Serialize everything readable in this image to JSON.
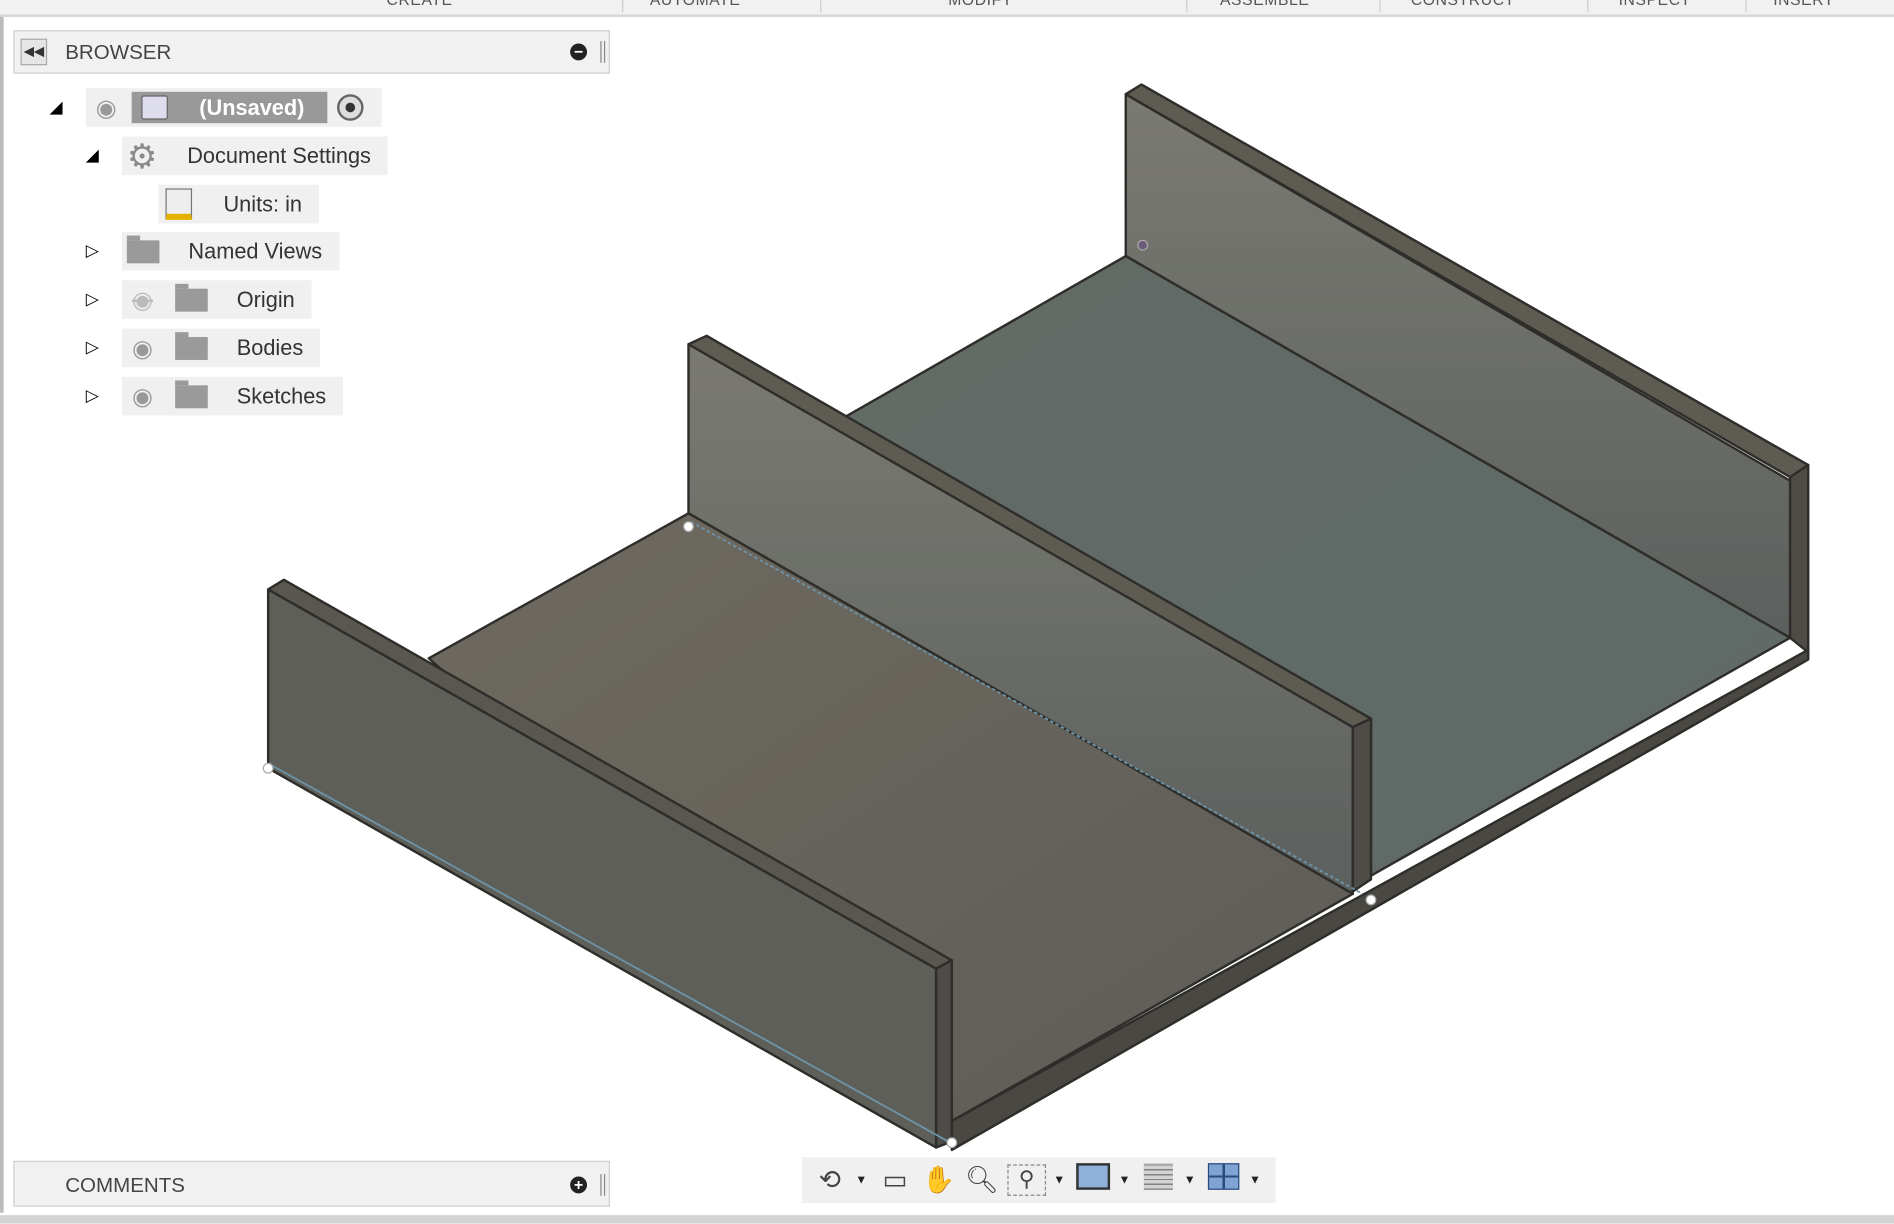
{
  "menubar": {
    "items": [
      "CREATE",
      "AUTOMATE",
      "MODIFY",
      "ASSEMBLE",
      "CONSTRUCT",
      "INSPECT",
      "INSERT"
    ]
  },
  "browser": {
    "title": "BROWSER",
    "root": {
      "label": "(Unsaved)"
    },
    "items": [
      {
        "label": "Document Settings",
        "icon": "gear-icon",
        "expanded": true
      },
      {
        "label": "Units: in",
        "icon": "units-document-icon"
      },
      {
        "label": "Named Views",
        "icon": "folder-icon"
      },
      {
        "label": "Origin",
        "icon": "folder-icon",
        "visible": false
      },
      {
        "label": "Bodies",
        "icon": "folder-icon",
        "visible": true
      },
      {
        "label": "Sketches",
        "icon": "folder-icon",
        "visible": true
      }
    ]
  },
  "comments": {
    "title": "COMMENTS"
  },
  "navbar": {
    "tools": [
      "orbit-icon",
      "look-at-icon",
      "pan-icon",
      "zoom-icon",
      "zoom-window-icon",
      "display-settings-icon",
      "grid-icon",
      "viewports-icon"
    ]
  },
  "colors": {
    "model_face": "#6b6a62",
    "model_edge": "#3a3833",
    "panel_bg": "#f1f1f1"
  }
}
